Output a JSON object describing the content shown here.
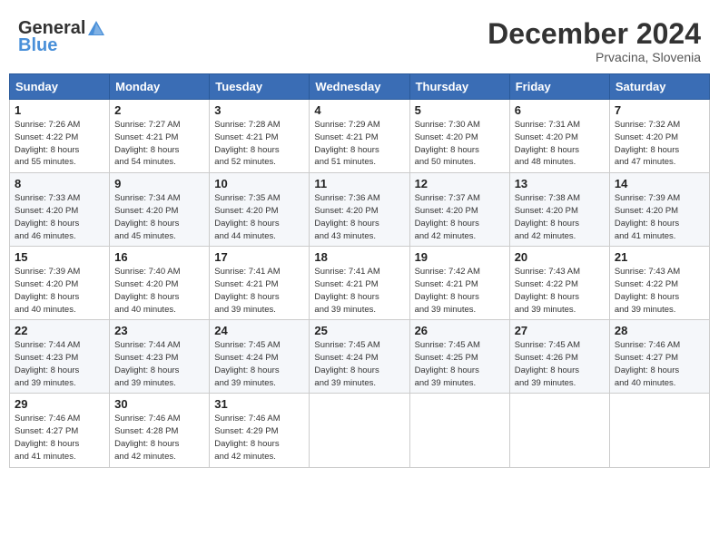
{
  "header": {
    "logo_general": "General",
    "logo_blue": "Blue",
    "month_title": "December 2024",
    "location": "Prvacina, Slovenia"
  },
  "days_of_week": [
    "Sunday",
    "Monday",
    "Tuesday",
    "Wednesday",
    "Thursday",
    "Friday",
    "Saturday"
  ],
  "weeks": [
    [
      {
        "day": "1",
        "sunrise": "7:26 AM",
        "sunset": "4:22 PM",
        "daylight": "8 hours and 55 minutes."
      },
      {
        "day": "2",
        "sunrise": "7:27 AM",
        "sunset": "4:21 PM",
        "daylight": "8 hours and 54 minutes."
      },
      {
        "day": "3",
        "sunrise": "7:28 AM",
        "sunset": "4:21 PM",
        "daylight": "8 hours and 52 minutes."
      },
      {
        "day": "4",
        "sunrise": "7:29 AM",
        "sunset": "4:21 PM",
        "daylight": "8 hours and 51 minutes."
      },
      {
        "day": "5",
        "sunrise": "7:30 AM",
        "sunset": "4:20 PM",
        "daylight": "8 hours and 50 minutes."
      },
      {
        "day": "6",
        "sunrise": "7:31 AM",
        "sunset": "4:20 PM",
        "daylight": "8 hours and 48 minutes."
      },
      {
        "day": "7",
        "sunrise": "7:32 AM",
        "sunset": "4:20 PM",
        "daylight": "8 hours and 47 minutes."
      }
    ],
    [
      {
        "day": "8",
        "sunrise": "7:33 AM",
        "sunset": "4:20 PM",
        "daylight": "8 hours and 46 minutes."
      },
      {
        "day": "9",
        "sunrise": "7:34 AM",
        "sunset": "4:20 PM",
        "daylight": "8 hours and 45 minutes."
      },
      {
        "day": "10",
        "sunrise": "7:35 AM",
        "sunset": "4:20 PM",
        "daylight": "8 hours and 44 minutes."
      },
      {
        "day": "11",
        "sunrise": "7:36 AM",
        "sunset": "4:20 PM",
        "daylight": "8 hours and 43 minutes."
      },
      {
        "day": "12",
        "sunrise": "7:37 AM",
        "sunset": "4:20 PM",
        "daylight": "8 hours and 42 minutes."
      },
      {
        "day": "13",
        "sunrise": "7:38 AM",
        "sunset": "4:20 PM",
        "daylight": "8 hours and 42 minutes."
      },
      {
        "day": "14",
        "sunrise": "7:39 AM",
        "sunset": "4:20 PM",
        "daylight": "8 hours and 41 minutes."
      }
    ],
    [
      {
        "day": "15",
        "sunrise": "7:39 AM",
        "sunset": "4:20 PM",
        "daylight": "8 hours and 40 minutes."
      },
      {
        "day": "16",
        "sunrise": "7:40 AM",
        "sunset": "4:20 PM",
        "daylight": "8 hours and 40 minutes."
      },
      {
        "day": "17",
        "sunrise": "7:41 AM",
        "sunset": "4:21 PM",
        "daylight": "8 hours and 39 minutes."
      },
      {
        "day": "18",
        "sunrise": "7:41 AM",
        "sunset": "4:21 PM",
        "daylight": "8 hours and 39 minutes."
      },
      {
        "day": "19",
        "sunrise": "7:42 AM",
        "sunset": "4:21 PM",
        "daylight": "8 hours and 39 minutes."
      },
      {
        "day": "20",
        "sunrise": "7:43 AM",
        "sunset": "4:22 PM",
        "daylight": "8 hours and 39 minutes."
      },
      {
        "day": "21",
        "sunrise": "7:43 AM",
        "sunset": "4:22 PM",
        "daylight": "8 hours and 39 minutes."
      }
    ],
    [
      {
        "day": "22",
        "sunrise": "7:44 AM",
        "sunset": "4:23 PM",
        "daylight": "8 hours and 39 minutes."
      },
      {
        "day": "23",
        "sunrise": "7:44 AM",
        "sunset": "4:23 PM",
        "daylight": "8 hours and 39 minutes."
      },
      {
        "day": "24",
        "sunrise": "7:45 AM",
        "sunset": "4:24 PM",
        "daylight": "8 hours and 39 minutes."
      },
      {
        "day": "25",
        "sunrise": "7:45 AM",
        "sunset": "4:24 PM",
        "daylight": "8 hours and 39 minutes."
      },
      {
        "day": "26",
        "sunrise": "7:45 AM",
        "sunset": "4:25 PM",
        "daylight": "8 hours and 39 minutes."
      },
      {
        "day": "27",
        "sunrise": "7:45 AM",
        "sunset": "4:26 PM",
        "daylight": "8 hours and 39 minutes."
      },
      {
        "day": "28",
        "sunrise": "7:46 AM",
        "sunset": "4:27 PM",
        "daylight": "8 hours and 40 minutes."
      }
    ],
    [
      {
        "day": "29",
        "sunrise": "7:46 AM",
        "sunset": "4:27 PM",
        "daylight": "8 hours and 41 minutes."
      },
      {
        "day": "30",
        "sunrise": "7:46 AM",
        "sunset": "4:28 PM",
        "daylight": "8 hours and 42 minutes."
      },
      {
        "day": "31",
        "sunrise": "7:46 AM",
        "sunset": "4:29 PM",
        "daylight": "8 hours and 42 minutes."
      },
      null,
      null,
      null,
      null
    ]
  ],
  "labels": {
    "sunrise": "Sunrise:",
    "sunset": "Sunset:",
    "daylight": "Daylight:"
  }
}
